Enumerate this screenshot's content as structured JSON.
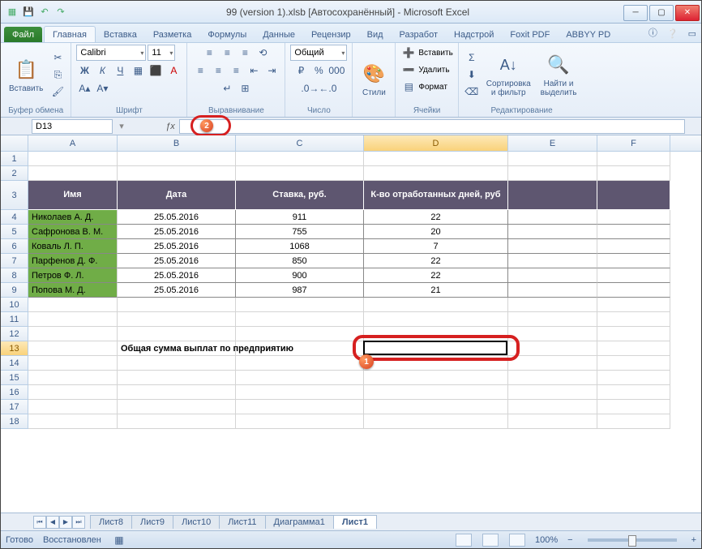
{
  "window": {
    "title": "99 (version 1).xlsb [Автосохранённый] - Microsoft Excel"
  },
  "ribbon_tabs": {
    "file": "Файл",
    "items": [
      "Главная",
      "Вставка",
      "Разметка",
      "Формулы",
      "Данные",
      "Рецензир",
      "Вид",
      "Разработ",
      "Надстрой",
      "Foxit PDF",
      "ABBYY PD"
    ],
    "active_index": 0
  },
  "ribbon": {
    "clipboard": {
      "paste": "Вставить",
      "label": "Буфер обмена"
    },
    "font": {
      "name": "Calibri",
      "size": "11",
      "label": "Шрифт"
    },
    "alignment": {
      "label": "Выравнивание"
    },
    "number": {
      "format": "Общий",
      "label": "Число"
    },
    "styles": {
      "btn": "Стили",
      "label": ""
    },
    "cells": {
      "insert": "Вставить",
      "delete": "Удалить",
      "format": "Формат",
      "label": "Ячейки"
    },
    "editing": {
      "sort": "Сортировка\nи фильтр",
      "find": "Найти и\nвыделить",
      "label": "Редактирование"
    }
  },
  "namebox": "D13",
  "columns": [
    "A",
    "B",
    "C",
    "D",
    "E",
    "F"
  ],
  "selected_col": "D",
  "selected_row": 13,
  "table": {
    "headers": [
      "Имя",
      "Дата",
      "Ставка, руб.",
      "К-во отработанных дней, руб"
    ],
    "rows": [
      [
        "Николаев А. Д.",
        "25.05.2016",
        "911",
        "22"
      ],
      [
        "Сафронова В. М.",
        "25.05.2016",
        "755",
        "20"
      ],
      [
        "Коваль Л. П.",
        "25.05.2016",
        "1068",
        "7"
      ],
      [
        "Парфенов Д. Ф.",
        "25.05.2016",
        "850",
        "22"
      ],
      [
        "Петров Ф. Л.",
        "25.05.2016",
        "900",
        "22"
      ],
      [
        "Попова М. Д.",
        "25.05.2016",
        "987",
        "21"
      ]
    ]
  },
  "total_label": "Общая сумма выплат по предприятию",
  "sheets": [
    "Лист8",
    "Лист9",
    "Лист10",
    "Лист11",
    "Диаграмма1",
    "Лист1"
  ],
  "active_sheet_index": 5,
  "status": {
    "ready": "Готово",
    "recovered": "Восстановлен",
    "zoom": "100%"
  },
  "callouts": {
    "b1": "1",
    "b2": "2"
  }
}
